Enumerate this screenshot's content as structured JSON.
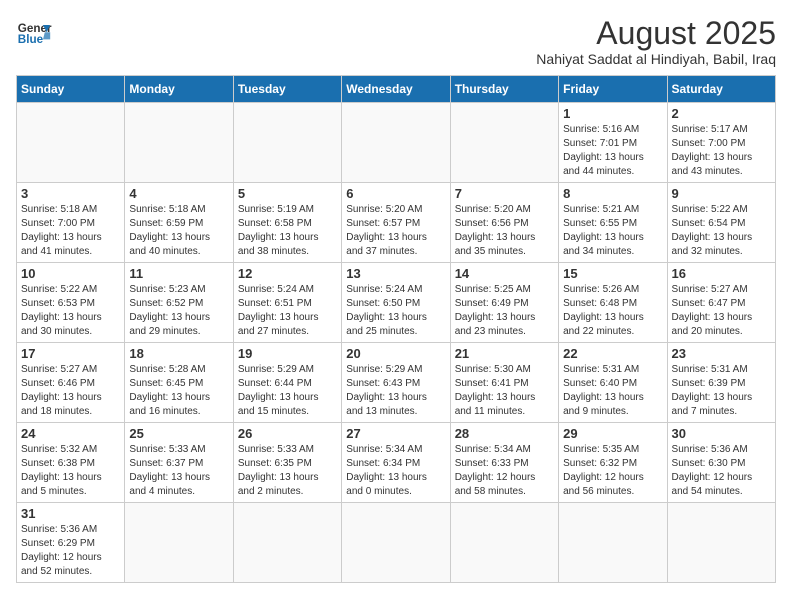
{
  "header": {
    "logo_line1": "General",
    "logo_line2": "Blue",
    "title": "August 2025",
    "subtitle": "Nahiyat Saddat al Hindiyah, Babil, Iraq"
  },
  "days_of_week": [
    "Sunday",
    "Monday",
    "Tuesday",
    "Wednesday",
    "Thursday",
    "Friday",
    "Saturday"
  ],
  "weeks": [
    [
      {
        "day": "",
        "info": ""
      },
      {
        "day": "",
        "info": ""
      },
      {
        "day": "",
        "info": ""
      },
      {
        "day": "",
        "info": ""
      },
      {
        "day": "",
        "info": ""
      },
      {
        "day": "1",
        "info": "Sunrise: 5:16 AM\nSunset: 7:01 PM\nDaylight: 13 hours and 44 minutes."
      },
      {
        "day": "2",
        "info": "Sunrise: 5:17 AM\nSunset: 7:00 PM\nDaylight: 13 hours and 43 minutes."
      }
    ],
    [
      {
        "day": "3",
        "info": "Sunrise: 5:18 AM\nSunset: 7:00 PM\nDaylight: 13 hours and 41 minutes."
      },
      {
        "day": "4",
        "info": "Sunrise: 5:18 AM\nSunset: 6:59 PM\nDaylight: 13 hours and 40 minutes."
      },
      {
        "day": "5",
        "info": "Sunrise: 5:19 AM\nSunset: 6:58 PM\nDaylight: 13 hours and 38 minutes."
      },
      {
        "day": "6",
        "info": "Sunrise: 5:20 AM\nSunset: 6:57 PM\nDaylight: 13 hours and 37 minutes."
      },
      {
        "day": "7",
        "info": "Sunrise: 5:20 AM\nSunset: 6:56 PM\nDaylight: 13 hours and 35 minutes."
      },
      {
        "day": "8",
        "info": "Sunrise: 5:21 AM\nSunset: 6:55 PM\nDaylight: 13 hours and 34 minutes."
      },
      {
        "day": "9",
        "info": "Sunrise: 5:22 AM\nSunset: 6:54 PM\nDaylight: 13 hours and 32 minutes."
      }
    ],
    [
      {
        "day": "10",
        "info": "Sunrise: 5:22 AM\nSunset: 6:53 PM\nDaylight: 13 hours and 30 minutes."
      },
      {
        "day": "11",
        "info": "Sunrise: 5:23 AM\nSunset: 6:52 PM\nDaylight: 13 hours and 29 minutes."
      },
      {
        "day": "12",
        "info": "Sunrise: 5:24 AM\nSunset: 6:51 PM\nDaylight: 13 hours and 27 minutes."
      },
      {
        "day": "13",
        "info": "Sunrise: 5:24 AM\nSunset: 6:50 PM\nDaylight: 13 hours and 25 minutes."
      },
      {
        "day": "14",
        "info": "Sunrise: 5:25 AM\nSunset: 6:49 PM\nDaylight: 13 hours and 23 minutes."
      },
      {
        "day": "15",
        "info": "Sunrise: 5:26 AM\nSunset: 6:48 PM\nDaylight: 13 hours and 22 minutes."
      },
      {
        "day": "16",
        "info": "Sunrise: 5:27 AM\nSunset: 6:47 PM\nDaylight: 13 hours and 20 minutes."
      }
    ],
    [
      {
        "day": "17",
        "info": "Sunrise: 5:27 AM\nSunset: 6:46 PM\nDaylight: 13 hours and 18 minutes."
      },
      {
        "day": "18",
        "info": "Sunrise: 5:28 AM\nSunset: 6:45 PM\nDaylight: 13 hours and 16 minutes."
      },
      {
        "day": "19",
        "info": "Sunrise: 5:29 AM\nSunset: 6:44 PM\nDaylight: 13 hours and 15 minutes."
      },
      {
        "day": "20",
        "info": "Sunrise: 5:29 AM\nSunset: 6:43 PM\nDaylight: 13 hours and 13 minutes."
      },
      {
        "day": "21",
        "info": "Sunrise: 5:30 AM\nSunset: 6:41 PM\nDaylight: 13 hours and 11 minutes."
      },
      {
        "day": "22",
        "info": "Sunrise: 5:31 AM\nSunset: 6:40 PM\nDaylight: 13 hours and 9 minutes."
      },
      {
        "day": "23",
        "info": "Sunrise: 5:31 AM\nSunset: 6:39 PM\nDaylight: 13 hours and 7 minutes."
      }
    ],
    [
      {
        "day": "24",
        "info": "Sunrise: 5:32 AM\nSunset: 6:38 PM\nDaylight: 13 hours and 5 minutes."
      },
      {
        "day": "25",
        "info": "Sunrise: 5:33 AM\nSunset: 6:37 PM\nDaylight: 13 hours and 4 minutes."
      },
      {
        "day": "26",
        "info": "Sunrise: 5:33 AM\nSunset: 6:35 PM\nDaylight: 13 hours and 2 minutes."
      },
      {
        "day": "27",
        "info": "Sunrise: 5:34 AM\nSunset: 6:34 PM\nDaylight: 13 hours and 0 minutes."
      },
      {
        "day": "28",
        "info": "Sunrise: 5:34 AM\nSunset: 6:33 PM\nDaylight: 12 hours and 58 minutes."
      },
      {
        "day": "29",
        "info": "Sunrise: 5:35 AM\nSunset: 6:32 PM\nDaylight: 12 hours and 56 minutes."
      },
      {
        "day": "30",
        "info": "Sunrise: 5:36 AM\nSunset: 6:30 PM\nDaylight: 12 hours and 54 minutes."
      }
    ],
    [
      {
        "day": "31",
        "info": "Sunrise: 5:36 AM\nSunset: 6:29 PM\nDaylight: 12 hours and 52 minutes."
      },
      {
        "day": "",
        "info": ""
      },
      {
        "day": "",
        "info": ""
      },
      {
        "day": "",
        "info": ""
      },
      {
        "day": "",
        "info": ""
      },
      {
        "day": "",
        "info": ""
      },
      {
        "day": "",
        "info": ""
      }
    ]
  ]
}
